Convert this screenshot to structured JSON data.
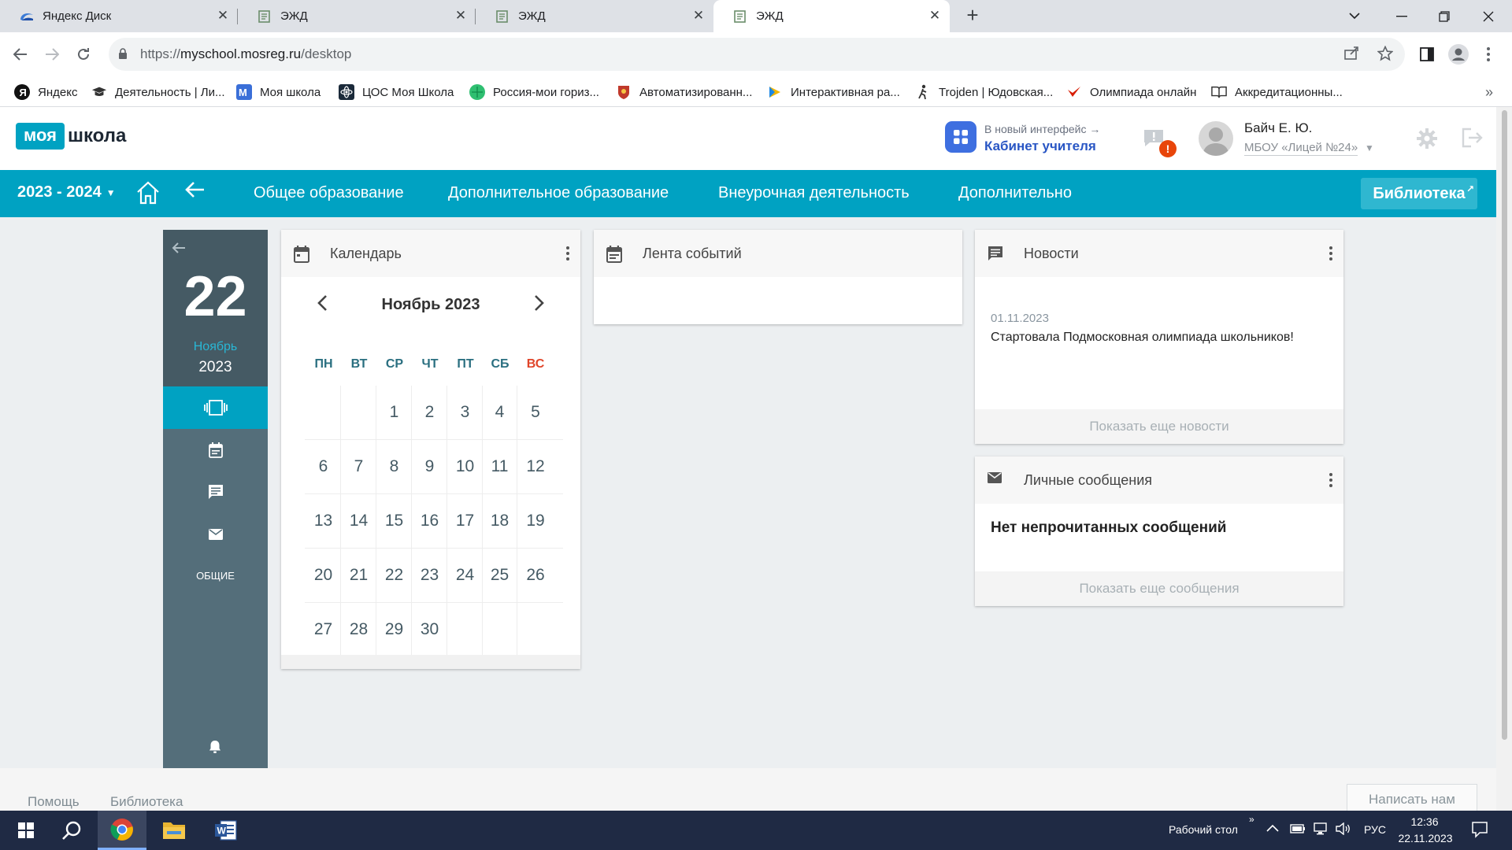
{
  "browser": {
    "tabs": [
      {
        "title": "Яндекс Диск",
        "icon": "yandex-disk-icon",
        "active": false
      },
      {
        "title": "ЭЖД",
        "icon": "ejd-icon",
        "active": false
      },
      {
        "title": "ЭЖД",
        "icon": "ejd-icon",
        "active": false
      },
      {
        "title": "ЭЖД",
        "icon": "ejd-icon",
        "active": true
      }
    ],
    "url_prefix": "https://",
    "url_host": "myschool.mosreg.ru",
    "url_path": "/desktop",
    "bookmarks": [
      {
        "label": "Яндекс",
        "icon": "yandex-icon",
        "color": "#000000"
      },
      {
        "label": "Деятельность | Ли...",
        "icon": "graduation-cap-icon",
        "color": "#333333"
      },
      {
        "label": "Моя школа",
        "icon": "m-logo-icon",
        "color": "#3a6fd8"
      },
      {
        "label": "ЦОС Моя Школа",
        "icon": "atom-icon",
        "color": "#222222"
      },
      {
        "label": "Россия-мои гориз...",
        "icon": "globe-icon",
        "color": "#2fbf71"
      },
      {
        "label": "Автоматизированн...",
        "icon": "emblem-icon",
        "color": "#c0392b"
      },
      {
        "label": "Интерактивная ра...",
        "icon": "play-icon",
        "color": "#f2b600"
      },
      {
        "label": "Trojden | Юдовская...",
        "icon": "runner-icon",
        "color": "#333333"
      },
      {
        "label": "Олимпиада онлайн",
        "icon": "check-icon",
        "color": "#d81e05"
      },
      {
        "label": "Аккредитационны...",
        "icon": "book-icon",
        "color": "#333333"
      }
    ]
  },
  "header": {
    "logo_part1": "моя",
    "logo_part2": "школа",
    "new_ui_hint": "В новый интерфейс →",
    "new_ui_link": "Кабинет учителя",
    "notification_badge": "!",
    "user_name": "Байч Е. Ю.",
    "user_school": "МБОУ «Лицей №24»"
  },
  "nav": {
    "year": "2023 - 2024",
    "links": [
      "Общее образование",
      "Дополнительное образование",
      "Внеурочная деятельность",
      "Дополнительно"
    ],
    "library_button": "Библиотека",
    "accent_color": "#00a2c2"
  },
  "sidebar": {
    "day": "22",
    "month": "Ноябрь",
    "year": "2023",
    "label": "ОБЩИЕ"
  },
  "calendar": {
    "title": "Календарь",
    "month_title": "Ноябрь 2023",
    "weekdays": [
      "ПН",
      "ВТ",
      "СР",
      "ЧТ",
      "ПТ",
      "СБ",
      "ВС"
    ],
    "weeks": [
      [
        "",
        "",
        "1",
        "2",
        "3",
        "4",
        "5"
      ],
      [
        "6",
        "7",
        "8",
        "9",
        "10",
        "11",
        "12"
      ],
      [
        "13",
        "14",
        "15",
        "16",
        "17",
        "18",
        "19"
      ],
      [
        "20",
        "21",
        "22",
        "23",
        "24",
        "25",
        "26"
      ],
      [
        "27",
        "28",
        "29",
        "30",
        "",
        "",
        ""
      ]
    ]
  },
  "events": {
    "title": "Лента событий"
  },
  "news": {
    "title": "Новости",
    "date": "01.11.2023",
    "text": "Стартовала Подмосковная олимпиада школьников!",
    "more": "Показать еще новости"
  },
  "messages": {
    "title": "Личные сообщения",
    "empty": "Нет непрочитанных сообщений",
    "more": "Показать еще сообщения"
  },
  "footer": {
    "help": "Помощь",
    "library": "Библиотека",
    "write_us": "Написать нам"
  },
  "taskbar": {
    "desktop_label": "Рабочий стол",
    "lang": "РУС",
    "time": "12:36",
    "date": "22.11.2023"
  }
}
